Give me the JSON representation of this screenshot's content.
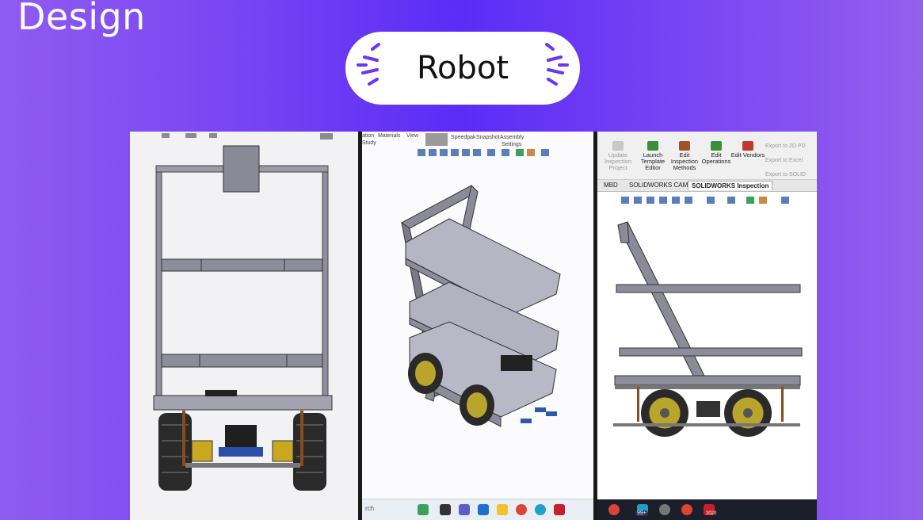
{
  "heading": "Design",
  "pill": {
    "title": "Robot"
  },
  "panels": [
    {
      "name": "front-view"
    },
    {
      "name": "isometric-view",
      "toolbar": [
        "ation",
        "Materials",
        "View",
        "Speedpak",
        "Snapshot",
        "Assembly",
        "Settings",
        "Study"
      ],
      "taskbar": {
        "search": "rch"
      }
    },
    {
      "name": "side-view",
      "ribbon_buttons": [
        {
          "label": "Update Inspection Project",
          "enabled": false
        },
        {
          "label": "Launch Template Editor",
          "enabled": true
        },
        {
          "label": "Edit Inspection Methods",
          "enabled": true
        },
        {
          "label": "Edit Operations",
          "enabled": true
        },
        {
          "label": "Edit Vendors",
          "enabled": true
        }
      ],
      "export_items": [
        "Export to 2D PD",
        "Export to Excel",
        "Export to SOLID"
      ],
      "tabs": [
        "MBD",
        "SOLIDWORKS CAM",
        "SOLIDWORKS Inspection"
      ],
      "active_tab": "SOLIDWORKS Inspection",
      "taskbar": {
        "badge": "99+",
        "app_label": "2020"
      }
    }
  ],
  "colors": {
    "frame": "#6f6f80",
    "tray": "#a9a9b8",
    "tire": "#2a2a2a",
    "hub": "#b9a52c"
  }
}
